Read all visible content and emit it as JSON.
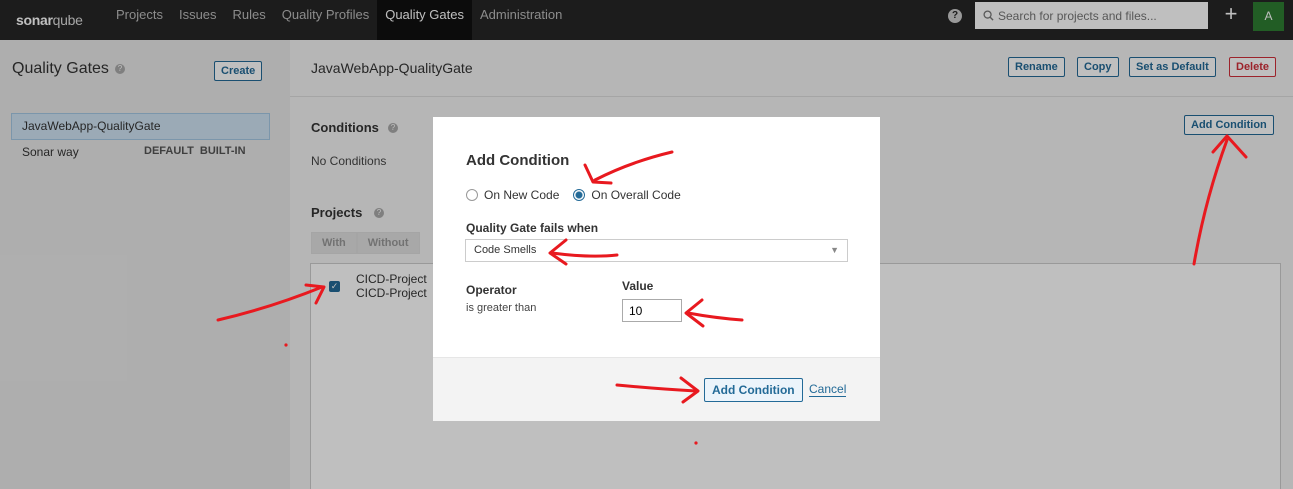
{
  "nav": {
    "logo_bold": "sonar",
    "logo_light": "qube",
    "items": [
      "Projects",
      "Issues",
      "Rules",
      "Quality Profiles",
      "Quality Gates",
      "Administration"
    ],
    "active": "Quality Gates",
    "search_placeholder": "Search for projects and files...",
    "avatar_letter": "A",
    "plus": "+",
    "help": "?"
  },
  "sidebar": {
    "title": "Quality Gates",
    "create_label": "Create",
    "gates": [
      {
        "name": "JavaWebApp-QualityGate",
        "selected": true
      },
      {
        "name": "Sonar way",
        "badges": [
          "DEFAULT",
          "BUILT-IN"
        ]
      }
    ]
  },
  "main": {
    "gate_title": "JavaWebApp-QualityGate",
    "actions": {
      "rename": "Rename",
      "copy": "Copy",
      "set_default": "Set as Default",
      "delete": "Delete"
    },
    "conditions_title": "Conditions",
    "no_conditions": "No Conditions",
    "add_condition_label": "Add Condition",
    "projects_title": "Projects",
    "tabs": [
      "With",
      "Without"
    ],
    "projects": [
      "CICD-Project",
      "CICD-Project"
    ]
  },
  "modal": {
    "title": "Add Condition",
    "radio_options": [
      {
        "label": "On New Code",
        "checked": false
      },
      {
        "label": "On Overall Code",
        "checked": true
      }
    ],
    "fails_when_label": "Quality Gate fails when",
    "metric_value": "Code Smells",
    "operator_label": "Operator",
    "operator_value": "is greater than",
    "value_label": "Value",
    "value": "10",
    "submit_label": "Add Condition",
    "cancel_label": "Cancel"
  },
  "colors": {
    "accent": "#236a97",
    "annotation": "#e8191f",
    "nav_bg": "#262626"
  }
}
